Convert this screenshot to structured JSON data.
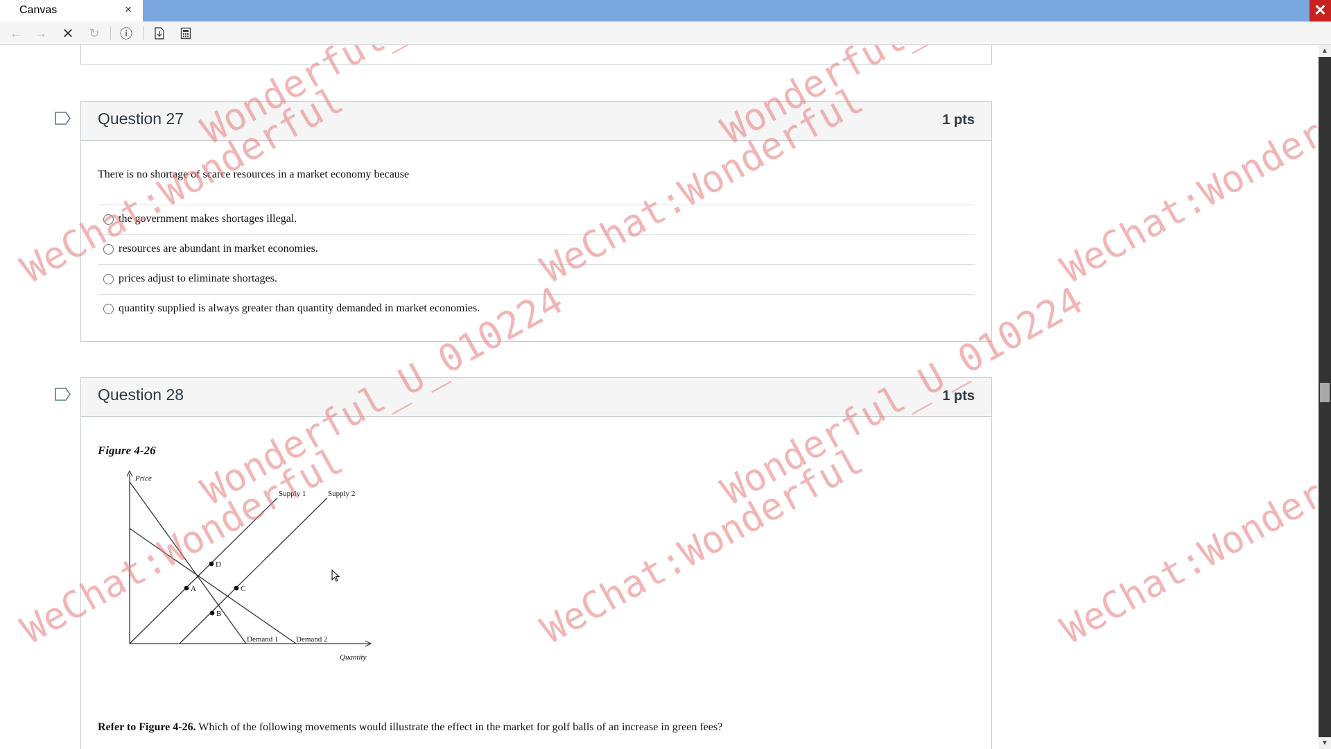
{
  "window": {
    "tab_title": "Canvas",
    "tab_close": "×",
    "close": "✕"
  },
  "toolbar": {
    "back_icon": "←",
    "forward_icon": "→",
    "stop_icon": "✕",
    "reload_icon": "↻",
    "info_icon": "ⓘ"
  },
  "watermark": {
    "id_text": "Wonderful_U_010224",
    "wechat_text": "WeChat:Wonderful"
  },
  "questions": [
    {
      "title": "Question 27",
      "points": "1 pts",
      "prompt": "There is no shortage of scarce resources in a market economy because",
      "answers": [
        "the government makes shortages illegal.",
        "resources are abundant in market economies.",
        "prices adjust to eliminate shortages.",
        "quantity supplied is always greater than quantity demanded in market economies."
      ]
    },
    {
      "title": "Question 28",
      "points": "1 pts",
      "figure_caption": "Figure 4-26",
      "figure": {
        "y_axis_label": "Price",
        "x_axis_label": "Quantity",
        "supply1": "Supply 1",
        "supply2": "Supply 2",
        "demand1": "Demand 1",
        "demand2": "Demand 2",
        "point_a": "A",
        "point_b": "B",
        "point_c": "C",
        "point_d": "D"
      },
      "prompt_bold": "Refer to Figure 4-26.",
      "prompt_rest": " Which of the following movements would illustrate the effect in the market for golf balls of an increase in green fees?"
    }
  ]
}
